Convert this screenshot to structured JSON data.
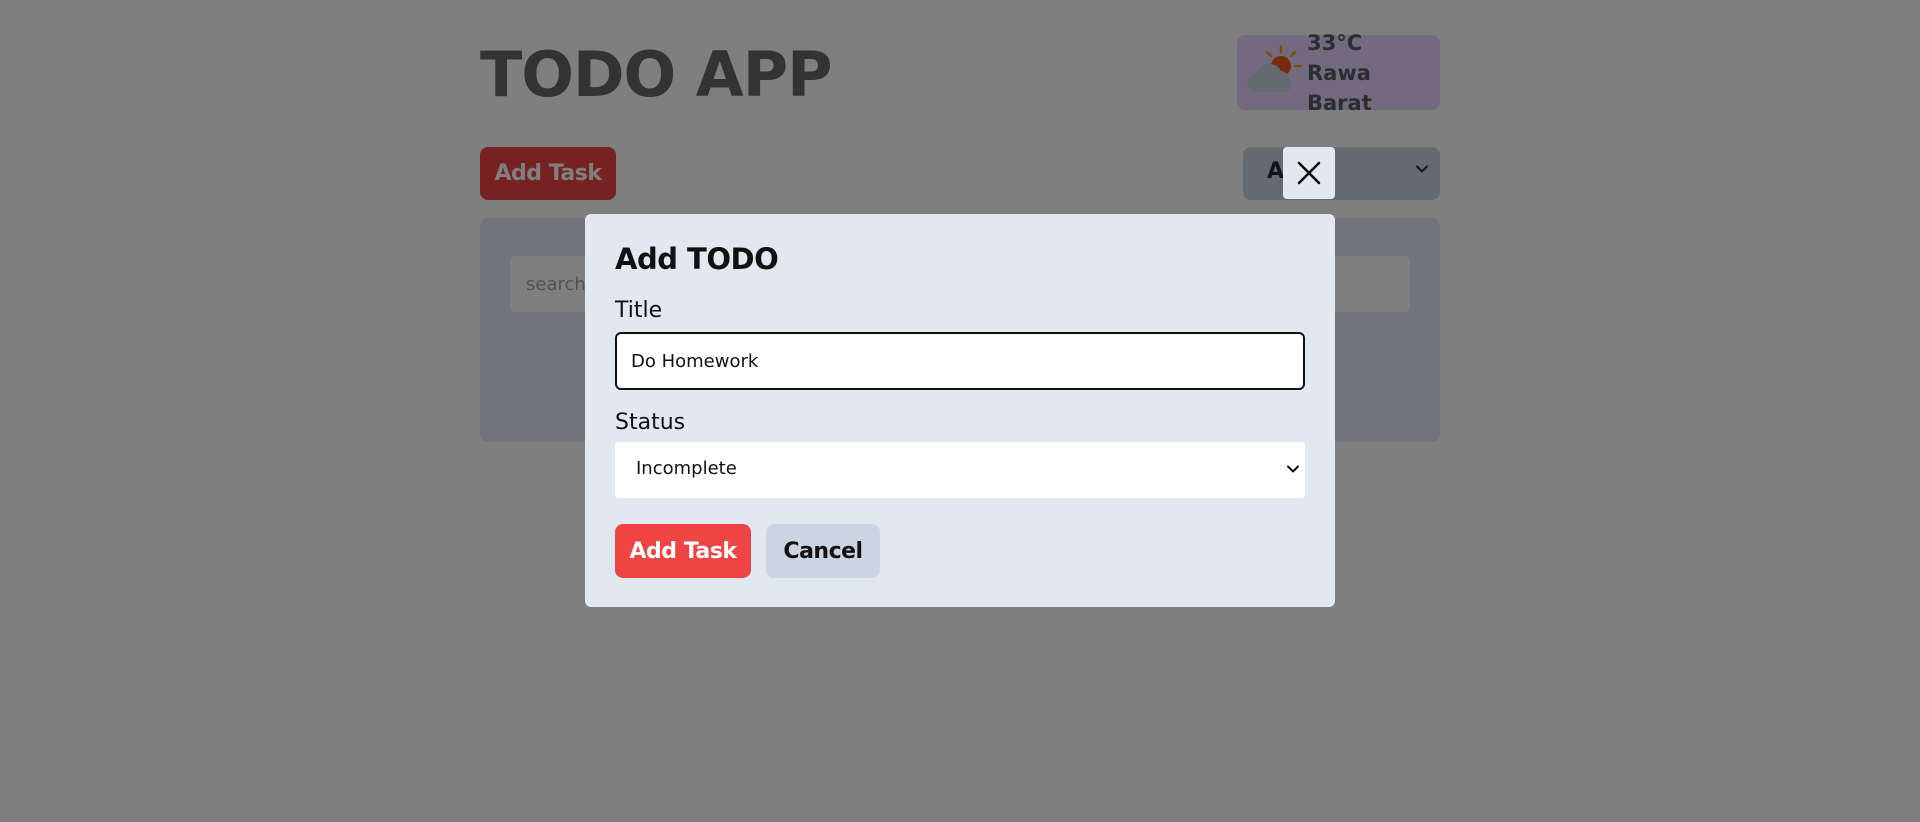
{
  "app": {
    "title": "TODO APP"
  },
  "weather": {
    "temperature": "33°C",
    "location": "Rawa Barat",
    "icon": "partly-cloudy-icon"
  },
  "toolbar": {
    "add_task_label": "Add Task",
    "filter_selected": "A"
  },
  "search": {
    "placeholder": "search"
  },
  "modal": {
    "title": "Add TODO",
    "title_label": "Title",
    "title_value": "Do Homework",
    "status_label": "Status",
    "status_selected": "Incomplete",
    "add_label": "Add Task",
    "cancel_label": "Cancel",
    "close_icon": "close-icon"
  },
  "colors": {
    "accent_red": "#ef4444",
    "modal_bg": "#e2e8f0",
    "weather_bg": "#e9d5ff",
    "secondary_btn": "#cbd5e1"
  }
}
